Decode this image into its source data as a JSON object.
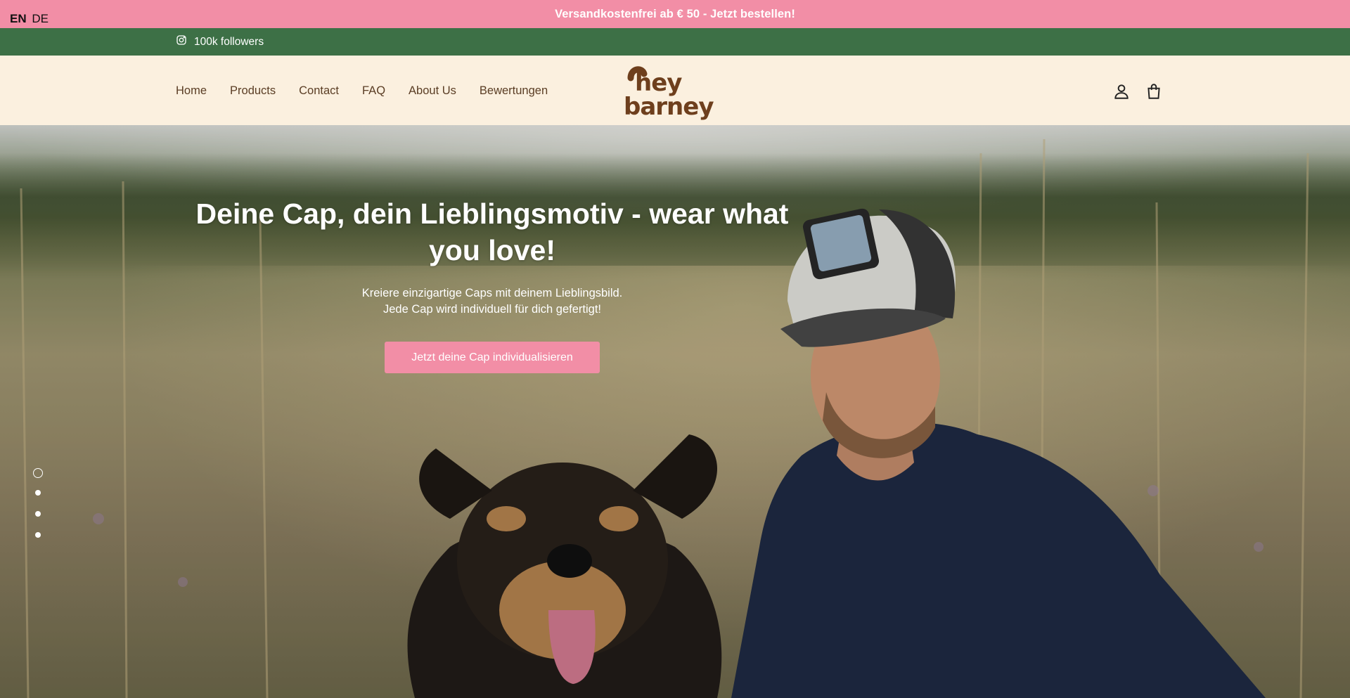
{
  "announcement": {
    "languages": [
      {
        "code": "EN",
        "active": true
      },
      {
        "code": "DE",
        "active": false
      }
    ],
    "text": "Versandkostenfrei ab € 50 - Jetzt bestellen!"
  },
  "social": {
    "icon": "instagram-icon",
    "label": "100k followers"
  },
  "header": {
    "nav": [
      "Home",
      "Products",
      "Contact",
      "FAQ",
      "About Us",
      "Bewertungen"
    ],
    "logo_text": [
      "hey",
      "barney"
    ],
    "icons": [
      "account-icon",
      "cart-icon"
    ]
  },
  "hero": {
    "title": "Deine Cap, dein Lieblingsmotiv - wear what you love!",
    "subtitle_line1": "Kreiere einzigartige Caps mit deinem Lieblingsbild.",
    "subtitle_line2": "Jede Cap wird individuell für dich gefertigt!",
    "cta": "Jetzt deine Cap individualisieren",
    "slides": 4,
    "active_slide": 1
  },
  "colors": {
    "announcement_bg": "#f28ea6",
    "social_bg": "#3d7046",
    "header_bg": "#fbf0df",
    "brand_brown": "#6e3f1d",
    "cta_bg": "#f28ea6"
  }
}
